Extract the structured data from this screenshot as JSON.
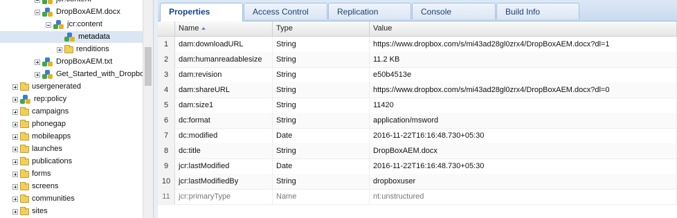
{
  "tree": {
    "items": [
      {
        "label": "jcr:content",
        "indent": 2,
        "kind": "node",
        "expander": "minus"
      },
      {
        "label": "DropBoxAEM.docx",
        "indent": 2,
        "kind": "node",
        "expander": "minus"
      },
      {
        "label": "jcr:content",
        "indent": 3,
        "kind": "node",
        "expander": "minus"
      },
      {
        "label": "metadata",
        "indent": 4,
        "kind": "node",
        "expander": "none",
        "selected": true
      },
      {
        "label": "renditions",
        "indent": 4,
        "kind": "folder",
        "expander": "plus"
      },
      {
        "label": "DropBoxAEM.txt",
        "indent": 2,
        "kind": "node",
        "expander": "plus"
      },
      {
        "label": "Get_Started_with_Dropbo",
        "indent": 2,
        "kind": "node",
        "expander": "plus"
      },
      {
        "label": "usergenerated",
        "indent": 0,
        "kind": "folder",
        "expander": "plus"
      },
      {
        "label": "rep:policy",
        "indent": 0,
        "kind": "node",
        "expander": "plus"
      },
      {
        "label": "campaigns",
        "indent": 0,
        "kind": "folder",
        "expander": "plus"
      },
      {
        "label": "phonegap",
        "indent": 0,
        "kind": "folder",
        "expander": "plus"
      },
      {
        "label": "mobileapps",
        "indent": 0,
        "kind": "folder",
        "expander": "plus"
      },
      {
        "label": "launches",
        "indent": 0,
        "kind": "folder",
        "expander": "plus"
      },
      {
        "label": "publications",
        "indent": 0,
        "kind": "folder",
        "expander": "plus"
      },
      {
        "label": "forms",
        "indent": 0,
        "kind": "folder",
        "expander": "plus"
      },
      {
        "label": "screens",
        "indent": 0,
        "kind": "folder",
        "expander": "plus"
      },
      {
        "label": "communities",
        "indent": 0,
        "kind": "folder",
        "expander": "plus"
      },
      {
        "label": "sites",
        "indent": 0,
        "kind": "folder",
        "expander": "plus"
      }
    ]
  },
  "tabs": [
    {
      "label": "Properties",
      "active": true
    },
    {
      "label": "Access Control"
    },
    {
      "label": "Replication"
    },
    {
      "label": "Console"
    },
    {
      "label": "Build Info"
    }
  ],
  "grid": {
    "columns": {
      "name": "Name",
      "type": "Type",
      "value": "Value"
    },
    "sort_icon": "sort-ascending-icon",
    "rows": [
      {
        "num": "1",
        "name": "dam:downloadURL",
        "type": "String",
        "value": "https://www.dropbox.com/s/mi43ad28gl0zrx4/DropBoxAEM.docx?dl=1"
      },
      {
        "num": "2",
        "name": "dam:humanreadablesize",
        "type": "String",
        "value": "11.2 KB"
      },
      {
        "num": "3",
        "name": "dam:revision",
        "type": "String",
        "value": "e50b4513e"
      },
      {
        "num": "4",
        "name": "dam:shareURL",
        "type": "String",
        "value": "https://www.dropbox.com/s/mi43ad28gl0zrx4/DropBoxAEM.docx?dl=0"
      },
      {
        "num": "5",
        "name": "dam:size1",
        "type": "String",
        "value": "11420"
      },
      {
        "num": "6",
        "name": "dc:format",
        "type": "String",
        "value": "application/msword"
      },
      {
        "num": "7",
        "name": "dc:modified",
        "type": "Date",
        "value": "2016-11-22T16:16:48.730+05:30"
      },
      {
        "num": "8",
        "name": "dc:title",
        "type": "String",
        "value": "DropBoxAEM.docx"
      },
      {
        "num": "9",
        "name": "jcr:lastModified",
        "type": "Date",
        "value": "2016-11-22T16:16:48.730+05:30"
      },
      {
        "num": "10",
        "name": "jcr:lastModifiedBy",
        "type": "String",
        "value": "dropboxuser"
      },
      {
        "num": "11",
        "name": "jcr:primaryType",
        "type": "Name",
        "value": "nt:unstructured",
        "muted": true
      }
    ]
  }
}
